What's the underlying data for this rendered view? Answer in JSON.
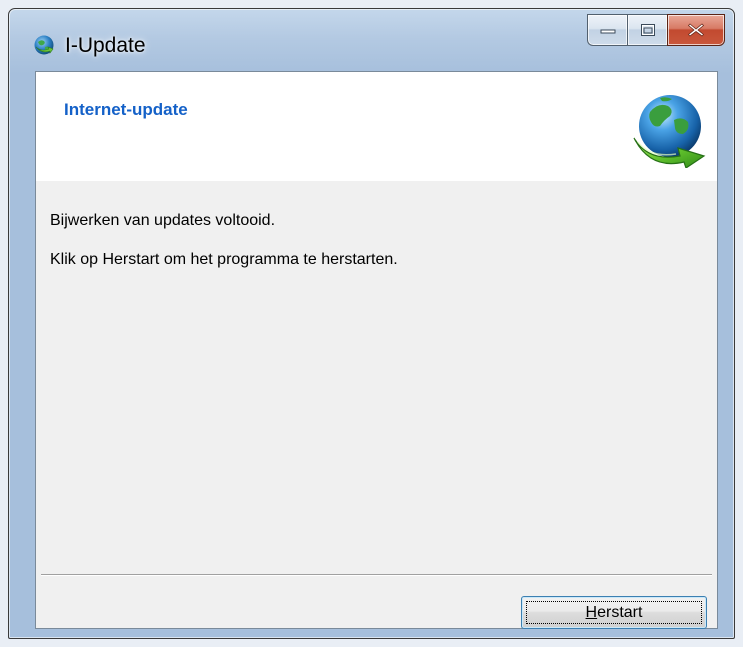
{
  "window": {
    "title": "I-Update",
    "title_icon": "globe-arrow-icon",
    "caption_buttons": {
      "minimize_icon": "minimize-icon",
      "maximize_icon": "maximize-icon",
      "close_icon": "close-icon"
    }
  },
  "header": {
    "title": "Internet-update",
    "icon": "globe-arrow-icon",
    "title_color": "#1461c8"
  },
  "content": {
    "message_line1": "Bijwerken van updates voltooid.",
    "message_line2": "Klik op Herstart om het programma te herstarten."
  },
  "footer": {
    "restart_button": {
      "mnemonic": "H",
      "label_rest": "erstart"
    }
  }
}
